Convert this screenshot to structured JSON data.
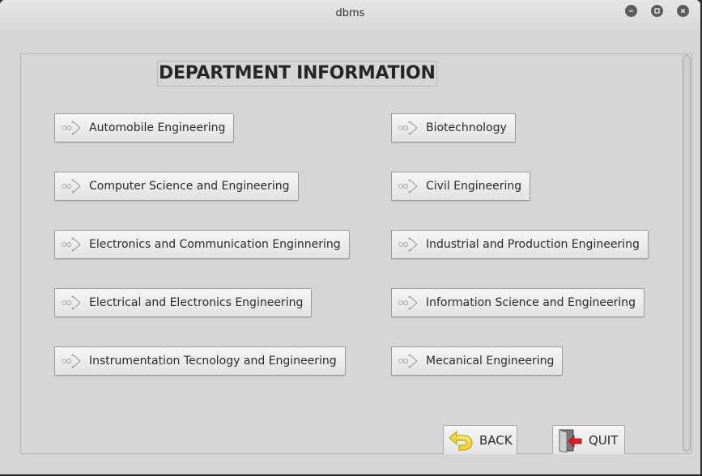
{
  "window": {
    "title": "dbms",
    "controls": [
      "minimize",
      "maximize",
      "close"
    ]
  },
  "heading": "DEPARTMENT INFORMATION",
  "departments_left": [
    {
      "label": "Automobile Engineering",
      "icon": "arrow-right-icon"
    },
    {
      "label": "Computer Science and Engineering",
      "icon": "arrow-right-icon"
    },
    {
      "label": "Electronics and Communication Enginnering",
      "icon": "arrow-right-icon"
    },
    {
      "label": "Electrical and Electronics Engineering",
      "icon": "arrow-right-icon"
    },
    {
      "label": "Instrumentation Tecnology and Engineering",
      "icon": "arrow-right-icon"
    }
  ],
  "departments_right": [
    {
      "label": "Biotechnology",
      "icon": "arrow-right-icon"
    },
    {
      "label": "Civil Engineering",
      "icon": "arrow-right-icon"
    },
    {
      "label": "Industrial and Production Engineering",
      "icon": "arrow-right-icon"
    },
    {
      "label": "Information Science and Engineering",
      "icon": "arrow-right-icon"
    },
    {
      "label": "Mecanical Engineering",
      "icon": "arrow-right-icon"
    }
  ],
  "actions": {
    "back_label": "BACK",
    "back_icon": "back-arrow-icon",
    "quit_label": "QUIT",
    "quit_icon": "exit-door-icon"
  },
  "colors": {
    "background": "#d6d6d6",
    "back_arrow": "#f2d43c",
    "quit_arrow": "#e02020"
  }
}
